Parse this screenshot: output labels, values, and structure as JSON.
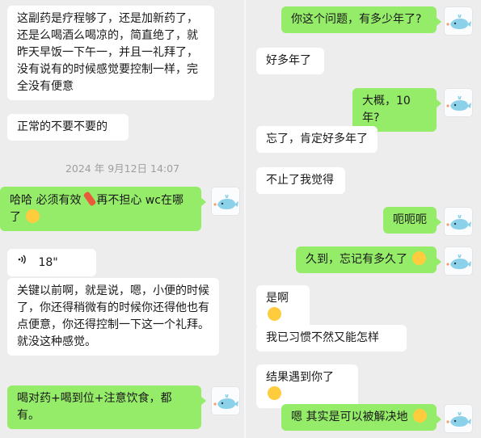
{
  "left_panel": {
    "msg1": "这副药是疗程够了，还是加新药了，还是么喝酒么喝凉的，简直绝了，就昨天早饭一下午一，并且一礼拜了，没有说有的时候感觉要控制一样，完全没有便意",
    "msg2": "正常的不要不要的",
    "timestamp": "2024 年 9月12日 14:07",
    "msg3": "哈哈 必须有效",
    "msg3_cont": "再不担心 wc在哪了",
    "voice_duration": "18\"",
    "msg4": "关键以前啊，就是说，嗯，小便的时候了，你还得稍微有的时候你还得他也有点便意，你还得控制一下这一个礼拜。就没这种感觉。",
    "msg5": "喝对药+喝到位+注意饮食，都有。"
  },
  "right_panel": {
    "msg1": "你这个问题，有多少年了?",
    "msg2": "好多年了",
    "msg3": "大概，10年?",
    "msg4": "忘了，肯定好多年了",
    "msg5": "不止了我觉得",
    "msg6": "呃呃呃",
    "msg7": "久到，忘记有多久了",
    "msg8": "是啊",
    "msg9": "我已习惯不然又能怎样",
    "msg10": "结果遇到你了",
    "msg11": "嗯 其实是可以被解决地"
  },
  "colors": {
    "background": "#ededed",
    "outgoing_bubble": "#95ec69",
    "incoming_bubble": "#ffffff",
    "timestamp_text": "#9e9e9e"
  },
  "icons": [
    "whale-avatar-icon",
    "voice-wave-icon",
    "firecracker-emoji-icon",
    "dizzy-emoji-icon",
    "grin-emoji-icon",
    "sweat-emoji-icon",
    "money-face-emoji-icon"
  ]
}
